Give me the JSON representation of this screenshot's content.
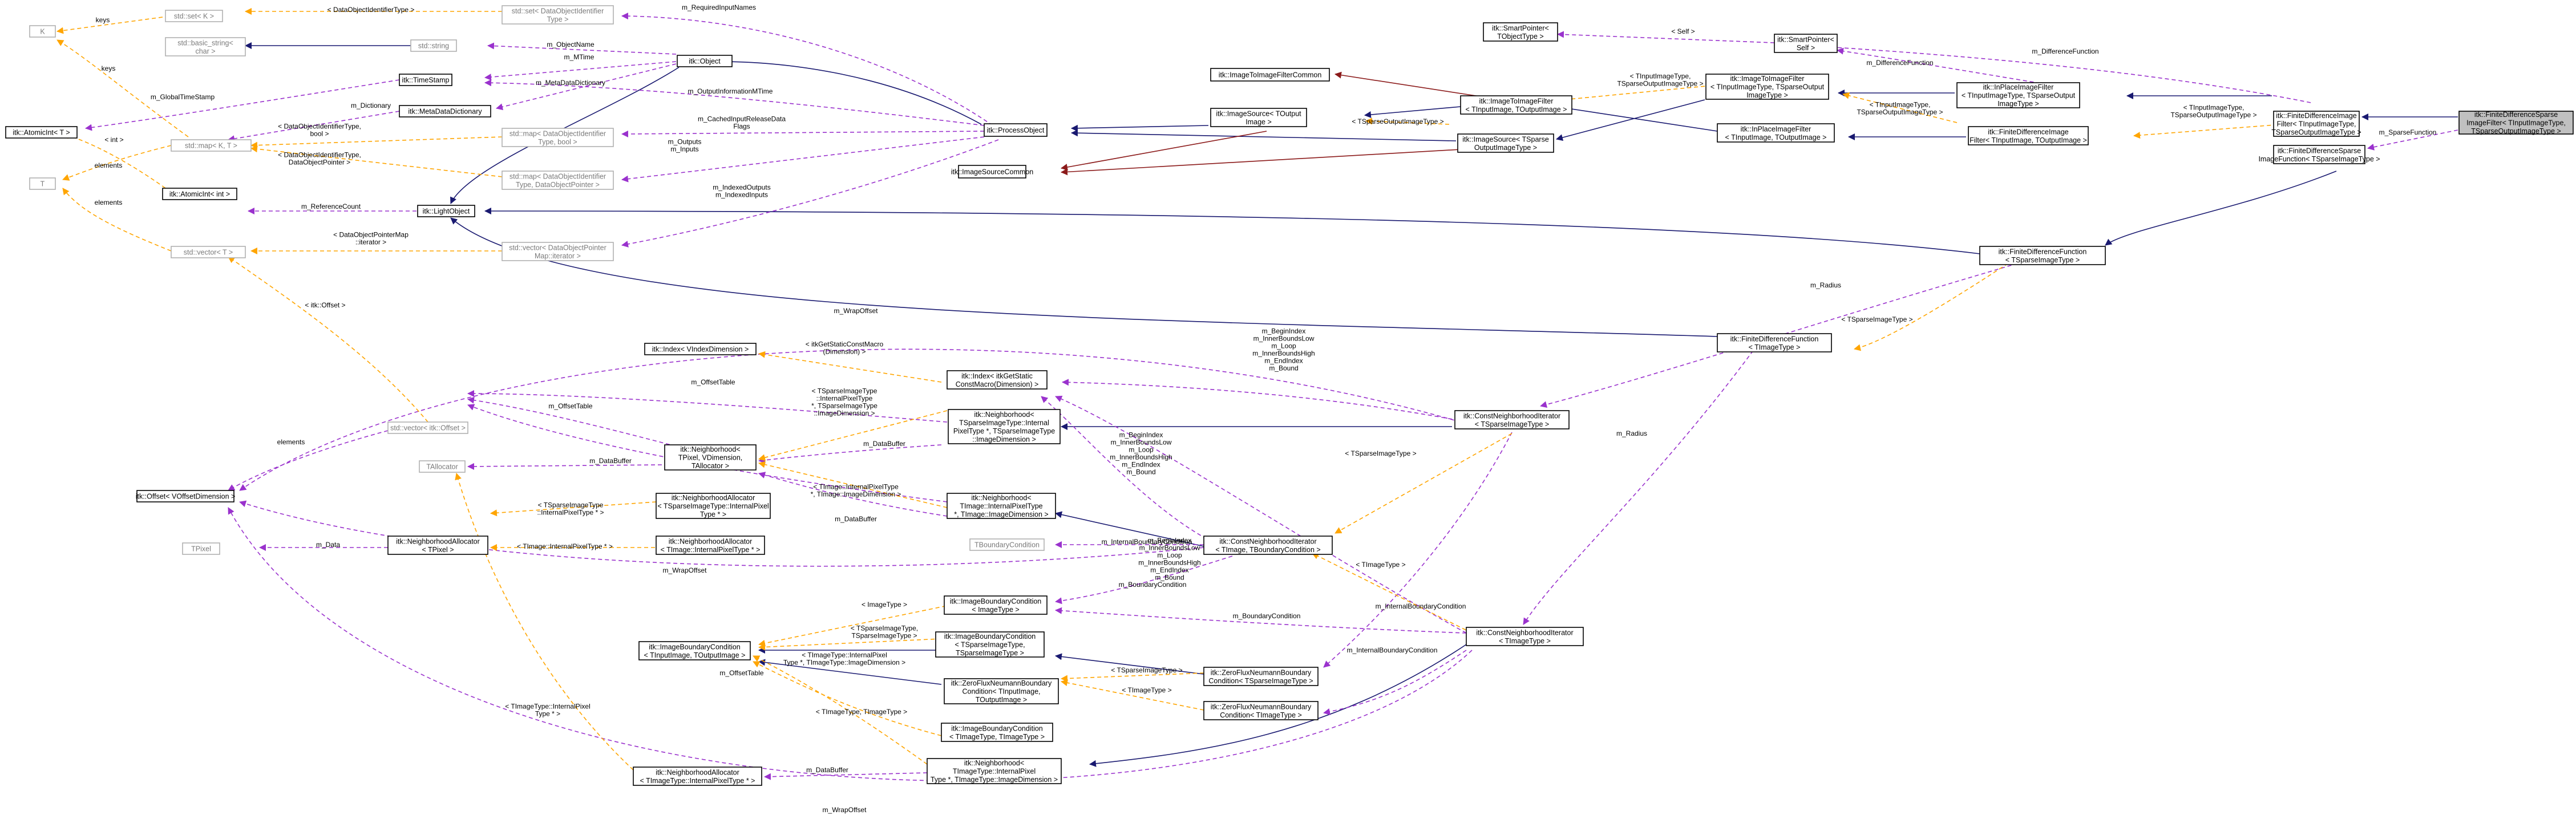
{
  "colors": {
    "inheritance": "#191970",
    "inheritance_alt": "#8b1a1a",
    "usage": "#9a32cd",
    "template": "#ffa500",
    "root_fill": "#c0c0c0",
    "external_border": "#b0b0b0"
  },
  "nodes": [
    {
      "id": "root",
      "lines": [
        "itk::FiniteDifferenceSparse",
        "ImageFilter< TInputImageType,",
        "TSparseOutputImageType >"
      ],
      "style": "root"
    },
    {
      "id": "fdif",
      "lines": [
        "itk::FiniteDifferenceImage",
        "Filter< TInputImageType,",
        "TSparseOutputImageType >"
      ],
      "style": "normal"
    },
    {
      "id": "fdsif",
      "lines": [
        "itk::FiniteDifferenceSparse",
        "ImageFunction< TSparseImageType >"
      ],
      "style": "normal"
    },
    {
      "id": "ipif_a",
      "lines": [
        "itk::InPlaceImageFilter",
        "< TInputImageType, TSparseOutput",
        "ImageType >"
      ],
      "style": "normal"
    },
    {
      "id": "smartptr_self",
      "lines": [
        "itk::SmartPointer<",
        "Self >"
      ],
      "style": "normal"
    },
    {
      "id": "fdf_a",
      "lines": [
        "itk::FiniteDifferenceImage",
        "Filter< TInputImage, TOutputImage >"
      ],
      "style": "normal"
    },
    {
      "id": "fdfunc_sparse",
      "lines": [
        "itk::FiniteDifferenceFunction",
        "< TSparseImageType >"
      ],
      "style": "normal"
    },
    {
      "id": "smartptr_obj",
      "lines": [
        "itk::SmartPointer<",
        "TObjectType >"
      ],
      "style": "normal"
    },
    {
      "id": "itif_a",
      "lines": [
        "itk::ImageToImageFilter",
        "< TInputImageType, TSparseOutput",
        "ImageType >"
      ],
      "style": "normal"
    },
    {
      "id": "ipif_b",
      "lines": [
        "itk::InPlaceImageFilter",
        "< TInputImage, TOutputImage >"
      ],
      "style": "normal"
    },
    {
      "id": "itifcommon",
      "lines": [
        "itk::ImageToImageFilterCommon"
      ],
      "style": "normal"
    },
    {
      "id": "itif_b",
      "lines": [
        "itk::ImageToImageFilter",
        "< TInputImage, TOutputImage >"
      ],
      "style": "normal"
    },
    {
      "id": "is_a",
      "lines": [
        "itk::ImageSource< TOutput",
        "Image >"
      ],
      "style": "normal"
    },
    {
      "id": "is_b",
      "lines": [
        "itk::ImageSource< TSparse",
        "OutputImageType >"
      ],
      "style": "normal"
    },
    {
      "id": "iscommon",
      "lines": [
        "itk::ImageSourceCommon"
      ],
      "style": "normal"
    },
    {
      "id": "procobj",
      "lines": [
        "itk::ProcessObject"
      ],
      "style": "normal"
    },
    {
      "id": "itkobject",
      "lines": [
        "itk::Object"
      ],
      "style": "normal"
    },
    {
      "id": "lightobj",
      "lines": [
        "itk::LightObject"
      ],
      "style": "normal"
    },
    {
      "id": "timestamp",
      "lines": [
        "itk::TimeStamp"
      ],
      "style": "normal"
    },
    {
      "id": "mdd",
      "lines": [
        "itk::MetaDataDictionary"
      ],
      "style": "normal"
    },
    {
      "id": "stdstring",
      "lines": [
        "std::string"
      ],
      "style": "grey"
    },
    {
      "id": "bstring",
      "lines": [
        "std::basic_string<",
        "char >"
      ],
      "style": "grey"
    },
    {
      "id": "stdset",
      "lines": [
        "std::set< K >"
      ],
      "style": "grey"
    },
    {
      "id": "setdoi",
      "lines": [
        "std::set< DataObjectIdentifier",
        "Type >"
      ],
      "style": "grey"
    },
    {
      "id": "K",
      "lines": [
        "K"
      ],
      "style": "grey"
    },
    {
      "id": "atomic_t",
      "lines": [
        "itk::AtomicInt< T >"
      ],
      "style": "normal"
    },
    {
      "id": "T",
      "lines": [
        "T"
      ],
      "style": "grey"
    },
    {
      "id": "stdmap",
      "lines": [
        "std::map< K, T >"
      ],
      "style": "grey"
    },
    {
      "id": "atomic_int",
      "lines": [
        "itk::AtomicInt< int >"
      ],
      "style": "normal"
    },
    {
      "id": "vector_t",
      "lines": [
        "std::vector< T >"
      ],
      "style": "grey"
    },
    {
      "id": "map_bool",
      "lines": [
        "std::map< DataObjectIdentifier",
        "Type, bool >"
      ],
      "style": "grey"
    },
    {
      "id": "map_dop",
      "lines": [
        "std::map< DataObjectIdentifier",
        "Type, DataObjectPointer >"
      ],
      "style": "grey"
    },
    {
      "id": "vec_dopit",
      "lines": [
        "std::vector< DataObjectPointer",
        "Map::iterator >"
      ],
      "style": "grey"
    },
    {
      "id": "fdfunc_t",
      "lines": [
        "itk::FiniteDifferenceFunction",
        "< TImageType >"
      ],
      "style": "normal"
    },
    {
      "id": "index_vdim",
      "lines": [
        "itk::Index< VIndexDimension >"
      ],
      "style": "normal"
    },
    {
      "id": "index_static",
      "lines": [
        "itk::Index< itkGetStatic",
        "ConstMacro(Dimension) >"
      ],
      "style": "normal"
    },
    {
      "id": "cnit_sparse",
      "lines": [
        "itk::ConstNeighborhoodIterator",
        "< TSparseImageType >"
      ],
      "style": "normal"
    },
    {
      "id": "vec_offset",
      "lines": [
        "std::vector< itk::Offset >"
      ],
      "style": "grey"
    },
    {
      "id": "nbh_sparse",
      "lines": [
        "itk::Neighborhood<",
        "TSparseImageType::Internal",
        "PixelType *, TSparseImageType",
        "::ImageDimension >"
      ],
      "style": "normal"
    },
    {
      "id": "nbh_generic",
      "lines": [
        "itk::Neighborhood<",
        "TPixel, VDimension,",
        "TAllocator >"
      ],
      "style": "normal"
    },
    {
      "id": "tallocator",
      "lines": [
        "TAllocator"
      ],
      "style": "grey"
    },
    {
      "id": "nbh_timage",
      "lines": [
        "itk::Neighborhood<",
        "TImage::InternalPixelType",
        " *, TImage::ImageDimension >"
      ],
      "style": "normal"
    },
    {
      "id": "offset_v",
      "lines": [
        "itk::Offset< VOffsetDimension >"
      ],
      "style": "normal"
    },
    {
      "id": "nalloc_sparse",
      "lines": [
        "itk::NeighborhoodAllocator",
        "< TSparseImageType::InternalPixel",
        "Type * >"
      ],
      "style": "normal"
    },
    {
      "id": "tbc",
      "lines": [
        "TBoundaryCondition"
      ],
      "style": "grey"
    },
    {
      "id": "cnit_tbc",
      "lines": [
        "itk::ConstNeighborhoodIterator",
        "< TImage, TBoundaryCondition >"
      ],
      "style": "normal"
    },
    {
      "id": "tpixel",
      "lines": [
        "TPixel"
      ],
      "style": "grey"
    },
    {
      "id": "nalloc_tpixel",
      "lines": [
        "itk::NeighborhoodAllocator",
        "< TPixel >"
      ],
      "style": "normal"
    },
    {
      "id": "nalloc_timage",
      "lines": [
        "itk::NeighborhoodAllocator",
        "< TImage::InternalPixelType * >"
      ],
      "style": "normal"
    },
    {
      "id": "ibc_imagetype",
      "lines": [
        "itk::ImageBoundaryCondition",
        "< ImageType >"
      ],
      "style": "normal"
    },
    {
      "id": "ibc_sparse",
      "lines": [
        "itk::ImageBoundaryCondition",
        "< TSparseImageType,",
        "TSparseImageType >"
      ],
      "style": "normal"
    },
    {
      "id": "ibc_generic",
      "lines": [
        "itk::ImageBoundaryCondition",
        "< TInputImage, TOutputImage >"
      ],
      "style": "normal"
    },
    {
      "id": "zfn_sparse",
      "lines": [
        "itk::ZeroFluxNeumannBoundary",
        "Condition< TSparseImageType >"
      ],
      "style": "normal"
    },
    {
      "id": "zfn_generic",
      "lines": [
        "itk::ZeroFluxNeumannBoundary",
        "Condition< TInputImage,",
        "TOutputImage >"
      ],
      "style": "normal"
    },
    {
      "id": "zfn_timagetype",
      "lines": [
        "itk::ZeroFluxNeumannBoundary",
        "Condition< TImageType >"
      ],
      "style": "normal"
    },
    {
      "id": "cnit_timagetype",
      "lines": [
        "itk::ConstNeighborhoodIterator",
        "< TImageType >"
      ],
      "style": "normal"
    },
    {
      "id": "ibc_timagetype",
      "lines": [
        "itk::ImageBoundaryCondition",
        "< TImageType, TImageType >"
      ],
      "style": "normal"
    },
    {
      "id": "nalloc_timagetype",
      "lines": [
        "itk::NeighborhoodAllocator",
        "< TImageType::InternalPixelType * >"
      ],
      "style": "normal"
    },
    {
      "id": "nbh_timagetype",
      "lines": [
        "itk::Neighborhood<",
        "TImageType::InternalPixel",
        "Type *, TImageType::ImageDimension >"
      ],
      "style": "normal"
    }
  ],
  "edge_labels": [
    {
      "id": "lbl_keys1",
      "lines": [
        "keys"
      ]
    },
    {
      "id": "lbl_doit1",
      "lines": [
        "< DataObjectIdentifierType >"
      ]
    },
    {
      "id": "lbl_reqinp",
      "lines": [
        "m_RequiredInputNames"
      ]
    },
    {
      "id": "lbl_self",
      "lines": [
        "< Self >"
      ]
    },
    {
      "id": "lbl_diffref",
      "lines": [
        "m_DifferenceFunction"
      ]
    },
    {
      "id": "lbl_diffref2",
      "lines": [
        "m_DifferenceFunction"
      ]
    },
    {
      "id": "lbl_objname",
      "lines": [
        "m_ObjectName"
      ]
    },
    {
      "id": "lbl_mtime",
      "lines": [
        "m_MTime"
      ]
    },
    {
      "id": "lbl_globalts",
      "lines": [
        "m_GlobalTimeStamp"
      ]
    },
    {
      "id": "lbl_mdd",
      "lines": [
        "m_MetaDataDictionary"
      ]
    },
    {
      "id": "lbl_dict",
      "lines": [
        "m_Dictionary"
      ]
    },
    {
      "id": "lbl_outinfo",
      "lines": [
        "m_OutputInformationMTime"
      ]
    },
    {
      "id": "lbl_t_int",
      "lines": [
        "< int >"
      ]
    },
    {
      "id": "lbl_elements1",
      "lines": [
        "elements"
      ]
    },
    {
      "id": "lbl_keys2",
      "lines": [
        "keys"
      ]
    },
    {
      "id": "lbl_doit_bool",
      "lines": [
        "< DataObjectIdentifierType,",
        "bool >"
      ]
    },
    {
      "id": "lbl_cached",
      "lines": [
        "m_CachedInputReleaseData",
        "Flags"
      ]
    },
    {
      "id": "lbl_doit_dop",
      "lines": [
        "< DataObjectIdentifierType,",
        "DataObjectPointer >"
      ]
    },
    {
      "id": "lbl_outputs",
      "lines": [
        "m_Outputs",
        "m_Inputs"
      ]
    },
    {
      "id": "lbl_refcount",
      "lines": [
        "m_ReferenceCount"
      ]
    },
    {
      "id": "lbl_elements2",
      "lines": [
        "elements"
      ]
    },
    {
      "id": "lbl_dopmap",
      "lines": [
        "< DataObjectPointerMap",
        "::iterator >"
      ]
    },
    {
      "id": "lbl_indexed",
      "lines": [
        "m_IndexedOutputs",
        "m_IndexedInputs"
      ]
    },
    {
      "id": "lbl_tinput1",
      "lines": [
        "< TInputImageType,",
        "TSparseOutputImageType >"
      ]
    },
    {
      "id": "lbl_tsparseout",
      "lines": [
        "< TSparseOutputImageType >"
      ]
    },
    {
      "id": "lbl_tinput2",
      "lines": [
        "< TInputImageType,",
        "TSparseOutputImageType >"
      ]
    },
    {
      "id": "lbl_tinput3",
      "lines": [
        "< TInputImageType,",
        "TSparseOutputImageType >"
      ]
    },
    {
      "id": "lbl_sparsefunc",
      "lines": [
        "m_SparseFunction"
      ]
    },
    {
      "id": "lbl_radius1",
      "lines": [
        "m_Radius"
      ]
    },
    {
      "id": "lbl_tsparse_img",
      "lines": [
        "< TSparseImageType >"
      ]
    },
    {
      "id": "lbl_itkoffset",
      "lines": [
        "< itk::Offset >"
      ]
    },
    {
      "id": "lbl_wrapoffset1",
      "lines": [
        "m_WrapOffset"
      ]
    },
    {
      "id": "lbl_getstatic",
      "lines": [
        "< itkGetStaticConstMacro",
        "(Dimension) >"
      ]
    },
    {
      "id": "lbl_beginidx1",
      "lines": [
        "m_BeginIndex",
        "m_InnerBoundsLow",
        "m_Loop",
        "m_InnerBoundsHigh",
        "m_EndIndex",
        "m_Bound"
      ]
    },
    {
      "id": "lbl_offsettable1",
      "lines": [
        "m_OffsetTable"
      ]
    },
    {
      "id": "lbl_tsparse_long",
      "lines": [
        "< TSparseImageType",
        "::InternalPixelType",
        " *, TSparseImageType",
        "::ImageDimension >"
      ]
    },
    {
      "id": "lbl_offsettable2",
      "lines": [
        "m_OffsetTable"
      ]
    },
    {
      "id": "lbl_databuffer1",
      "lines": [
        "m_DataBuffer"
      ]
    },
    {
      "id": "lbl_databuffer2",
      "lines": [
        "m_DataBuffer"
      ]
    },
    {
      "id": "lbl_radius2",
      "lines": [
        "m_Radius"
      ]
    },
    {
      "id": "lbl_elements3",
      "lines": [
        "elements"
      ]
    },
    {
      "id": "lbl_beginidx2",
      "lines": [
        "m_BeginIndex",
        "m_InnerBoundsLow",
        "m_Loop",
        "m_InnerBoundsHigh",
        "m_EndIndex",
        "m_Bound"
      ]
    },
    {
      "id": "lbl_beginidx3",
      "lines": [
        "m_BeginIndex",
        "m_InnerBoundsLow",
        "m_Loop",
        "m_InnerBoundsHigh",
        "m_EndIndex",
        "m_Bound"
      ]
    },
    {
      "id": "lbl_tsparse_img2",
      "lines": [
        "< TSparseImageType >"
      ]
    },
    {
      "id": "lbl_timage_internal",
      "lines": [
        "< TImage::InternalPixelType",
        " *, TImage::ImageDimension >"
      ]
    },
    {
      "id": "lbl_tsparse_internal2",
      "lines": [
        "< TSparseImageType",
        "::InternalPixelType * >"
      ]
    },
    {
      "id": "lbl_databuffer3",
      "lines": [
        "m_DataBuffer"
      ]
    },
    {
      "id": "lbl_data",
      "lines": [
        "m_Data"
      ]
    },
    {
      "id": "lbl_timage_internal2",
      "lines": [
        "< TImage::InternalPixelType * >"
      ]
    },
    {
      "id": "lbl_internalbc1",
      "lines": [
        "m_InternalBoundaryCondition"
      ]
    },
    {
      "id": "lbl_boundarycond1",
      "lines": [
        "m_BoundaryCondition"
      ]
    },
    {
      "id": "lbl_timagetype1",
      "lines": [
        "< TImageType >"
      ]
    },
    {
      "id": "lbl_wrapoffset2",
      "lines": [
        "m_WrapOffset"
      ]
    },
    {
      "id": "lbl_imagetype",
      "lines": [
        "< ImageType >"
      ]
    },
    {
      "id": "lbl_tsparse_pair",
      "lines": [
        "< TSparseImageType,",
        "TSparseImageType >"
      ]
    },
    {
      "id": "lbl_timagetype_internal",
      "lines": [
        "< TImageType::InternalPixel",
        "Type *, TImageType::ImageDimension >"
      ]
    },
    {
      "id": "lbl_boundarycond2",
      "lines": [
        "m_BoundaryCondition"
      ]
    },
    {
      "id": "lbl_internalbc2",
      "lines": [
        "m_InternalBoundaryCondition"
      ]
    },
    {
      "id": "lbl_tsparse_img3",
      "lines": [
        "< TSparseImageType >"
      ]
    },
    {
      "id": "lbl_offsettable3",
      "lines": [
        "m_OffsetTable"
      ]
    },
    {
      "id": "lbl_timagetype2",
      "lines": [
        "< TImageType >"
      ]
    },
    {
      "id": "lbl_timagetype_pair",
      "lines": [
        "< TImageType, TImageType >"
      ]
    },
    {
      "id": "lbl_internalbc3",
      "lines": [
        "m_InternalBoundaryCondition"
      ]
    },
    {
      "id": "lbl_timagetype_internal2",
      "lines": [
        "< TImageType::InternalPixel",
        "Type * >"
      ]
    },
    {
      "id": "lbl_databuffer4",
      "lines": [
        "m_DataBuffer"
      ]
    },
    {
      "id": "lbl_wrapoffset3",
      "lines": [
        "m_WrapOffset"
      ]
    }
  ]
}
